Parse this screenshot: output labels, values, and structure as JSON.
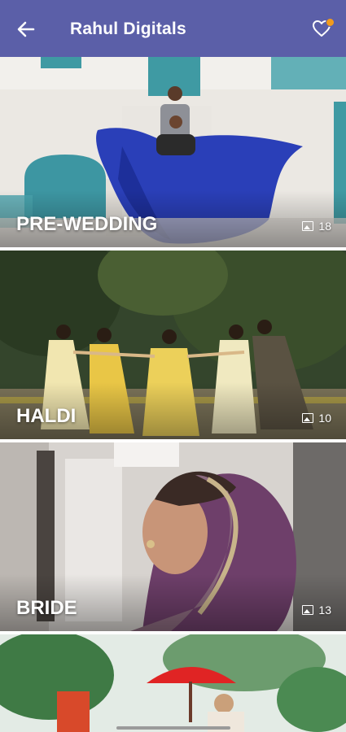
{
  "appbar": {
    "title": "Rahul Digitals",
    "back_icon": "arrow-left-icon",
    "favorite_icon": "heart-icon",
    "badge_color": "#f29b1d",
    "bar_color": "#5b5fa8"
  },
  "albums": [
    {
      "title": "PRE-WEDDING",
      "count": "18",
      "count_icon": "image-icon"
    },
    {
      "title": "HALDI",
      "count": "10",
      "count_icon": "image-icon"
    },
    {
      "title": "BRIDE",
      "count": "13",
      "count_icon": "image-icon"
    },
    {
      "title": "",
      "count": "",
      "count_icon": "image-icon"
    }
  ]
}
